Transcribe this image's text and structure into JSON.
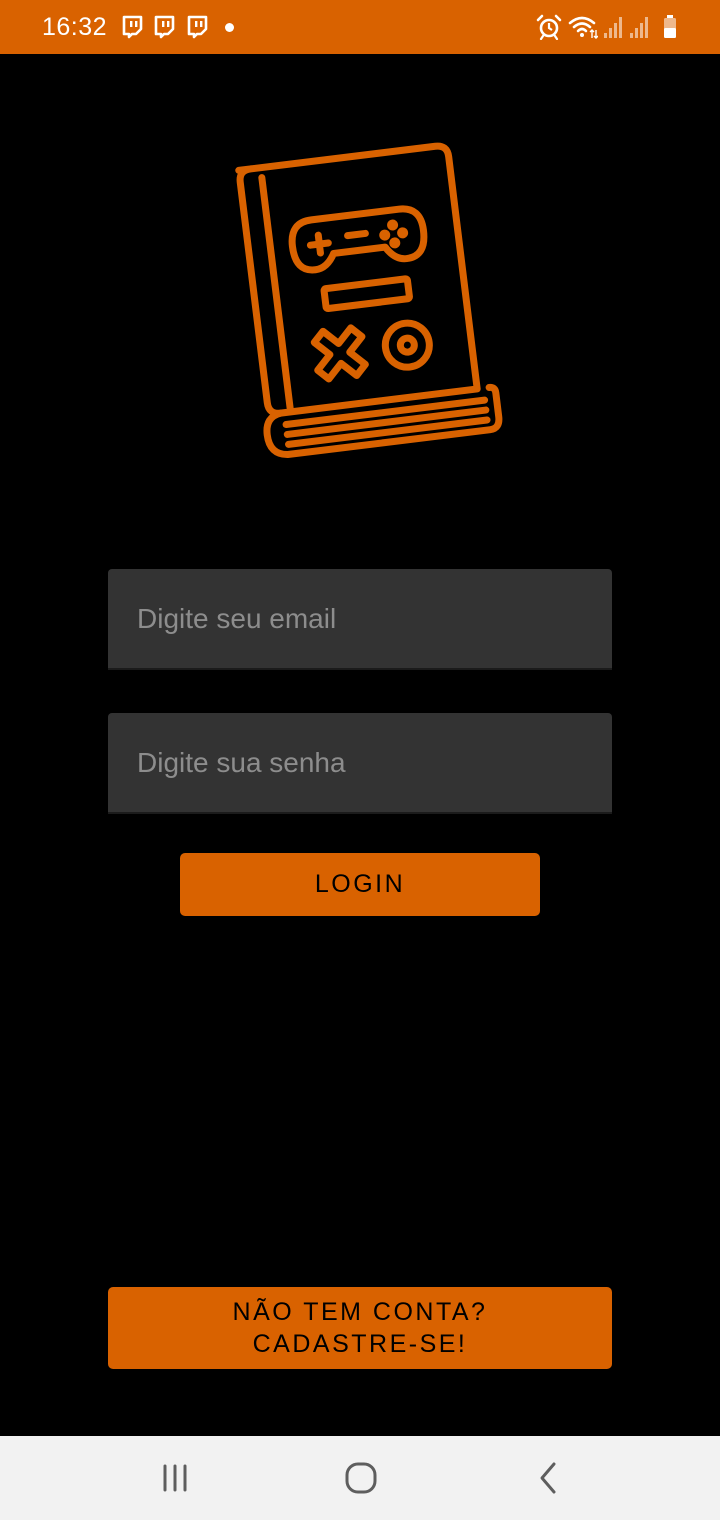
{
  "status_bar": {
    "time": "16:32",
    "notification_icons": [
      "twitch-icon",
      "twitch-icon",
      "twitch-icon"
    ],
    "right_icons": [
      "alarm-icon",
      "wifi-icon",
      "signal-icon",
      "signal-icon",
      "battery-icon"
    ]
  },
  "logo": {
    "icon": "game-book-logo-icon"
  },
  "login_form": {
    "email_placeholder": "Digite seu email",
    "email_value": "",
    "password_placeholder": "Digite sua senha",
    "password_value": "",
    "login_label": "LOGIN"
  },
  "signup": {
    "line1": "NÃO TEM CONTA?",
    "line2": "CADASTRE-SE!"
  },
  "nav_bar": {
    "items": [
      "recent-apps-icon",
      "home-icon",
      "back-icon"
    ]
  },
  "colors": {
    "accent": "#d96200",
    "background": "#000000",
    "input_background": "#333333",
    "nav_background": "#f2f2f2"
  }
}
